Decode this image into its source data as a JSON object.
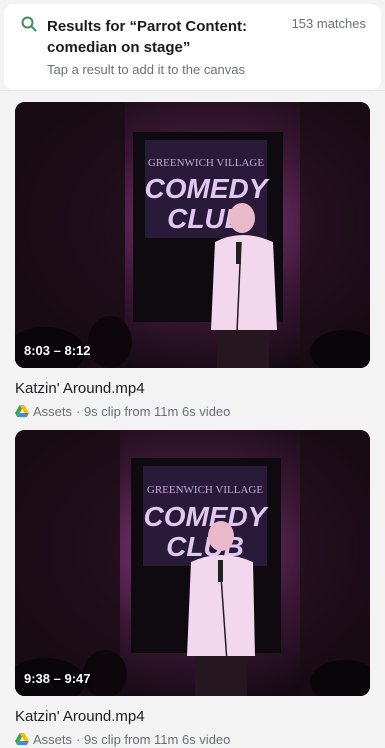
{
  "header": {
    "title": "Results for “Parrot Content: comedian on stage”",
    "match_count": "153 matches",
    "hint": "Tap a result to add it to the canvas"
  },
  "results": [
    {
      "time_range": "8:03 – 8:12",
      "filename": "Katzin' Around.mp4",
      "source": "Assets",
      "description": "· 9s clip from 11m 6s video",
      "sign_line1": "GREENWICH VILLAGE",
      "sign_line2": "COMEDY",
      "sign_line3": "CLUB"
    },
    {
      "time_range": "9:38 – 9:47",
      "filename": "Katzin' Around.mp4",
      "source": "Assets",
      "description": "· 9s clip from 11m 6s video",
      "sign_line1": "GREENWICH VILLAGE",
      "sign_line2": "COMEDY",
      "sign_line3": "CLUB"
    }
  ],
  "colors": {
    "accent_icon": "#3f8f5a",
    "text_primary": "#1d1d1f",
    "text_secondary": "#6b6f76",
    "stage_glow": "#8c3a86"
  },
  "icons": {
    "search": "search-icon",
    "source": "google-drive-icon"
  }
}
